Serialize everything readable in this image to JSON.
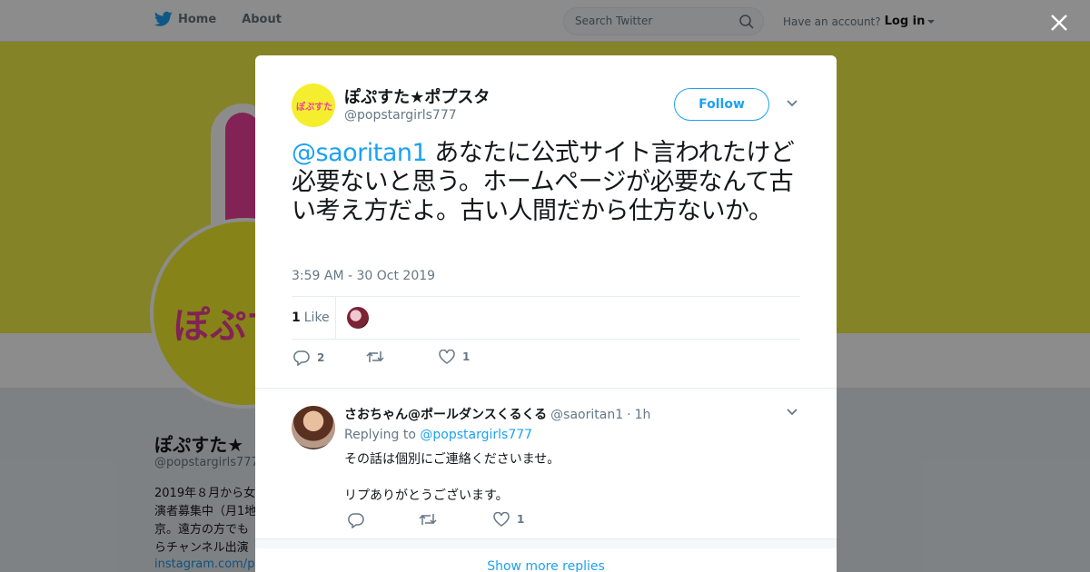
{
  "nav": {
    "home_label": "Home",
    "about_label": "About",
    "search_placeholder": "Search Twitter",
    "account_prompt": "Have an account?",
    "login_label": "Log in"
  },
  "background_profile": {
    "avatar_text": "ぽぷす",
    "name": "ぽぷすた★",
    "handle": "@popstargirls777",
    "bio_lines": [
      "2019年８月から女",
      "演者募集中（月1地",
      "京。遠方の方でも",
      "らチャンネル出演"
    ],
    "link_text": "instagram.com/po"
  },
  "tweet": {
    "avatar_text": "ぽぷすた",
    "author_name": "ぽぷすた★ポプスタ",
    "author_handle": "@popstargirls777",
    "follow_label": "Follow",
    "mention": "@saoritan1",
    "text": " あなたに公式サイト言われたけど必要ないと思う。ホームページが必要なんて古い考え方だよ。古い人間だから仕方ないか。",
    "timestamp": "3:59 AM - 30 Oct 2019",
    "like_count": "1",
    "like_label": "Like",
    "reply_count": "2",
    "retweet_count": "",
    "heart_count": "1"
  },
  "reply": {
    "name": "さおちゃん@ポールダンスくるくる",
    "handle": "@saoritan1",
    "separator": "·",
    "time": "1h",
    "replying_prefix": "Replying to ",
    "replying_to": "@popstargirls777",
    "body_line1": "その話は個別にご連絡くださいませ。",
    "body_line2": "リプありがとうございます。",
    "reply_count": "",
    "retweet_count": "",
    "heart_count": "1"
  },
  "show_more_label": "Show more replies",
  "colors": {
    "accent": "#1da1f2",
    "banner": "#f2ef48",
    "brand_pink": "#ee3f9a"
  }
}
